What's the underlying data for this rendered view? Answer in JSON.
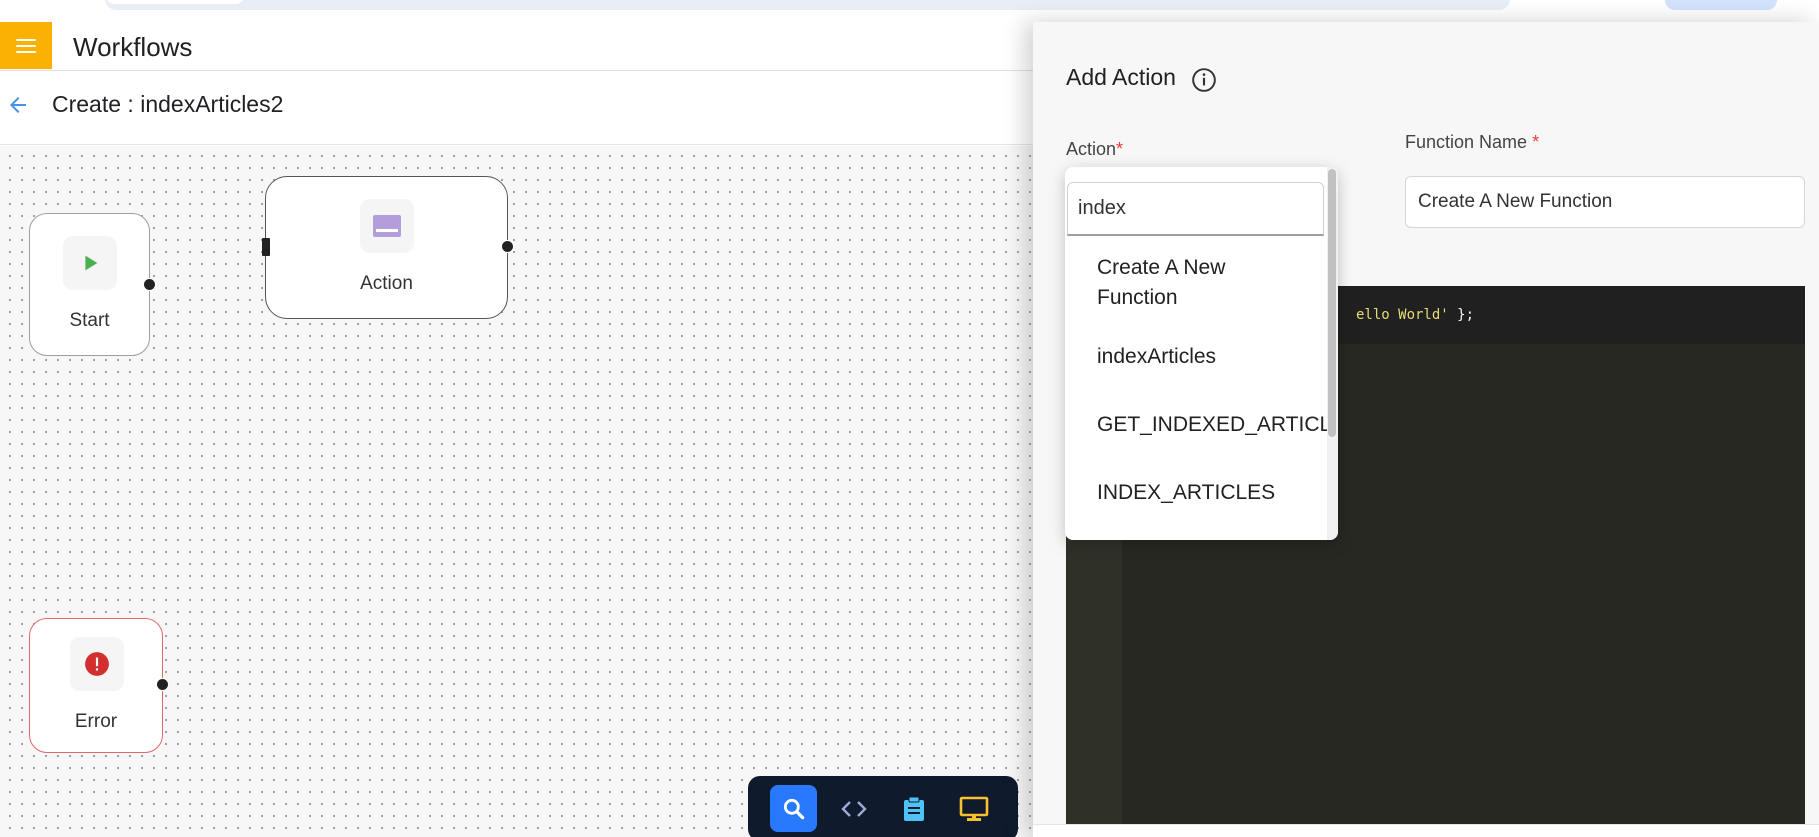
{
  "header": {
    "title": "Workflows"
  },
  "subheader": {
    "title": "Create : indexArticles2"
  },
  "canvas": {
    "nodes": {
      "start": {
        "label": "Start"
      },
      "action": {
        "label": "Action"
      },
      "error": {
        "label": "Error"
      }
    }
  },
  "panel": {
    "title": "Add Action",
    "action_label": "Action",
    "function_name_label": "Function Name",
    "required_mark": "*",
    "function_name_value": "Create A New Function",
    "code_fragment": "ello World'",
    "code_tail": " };"
  },
  "dropdown": {
    "search_value": "index",
    "items": [
      "Create A New Function",
      "indexArticles",
      "GET_INDEXED_ARTICLES",
      "INDEX_ARTICLES"
    ]
  },
  "toolbar": {
    "buttons": [
      "search-icon",
      "code-icon",
      "clipboard-icon",
      "monitor-icon"
    ],
    "active_color": "#2979ff"
  },
  "colors": {
    "menu_accent": "#fbb104",
    "start_icon": "#4caf50",
    "action_icon": "#b39ddb",
    "error_icon": "#d32f2f",
    "back_arrow": "#4a90e2",
    "required": "#e53935"
  }
}
